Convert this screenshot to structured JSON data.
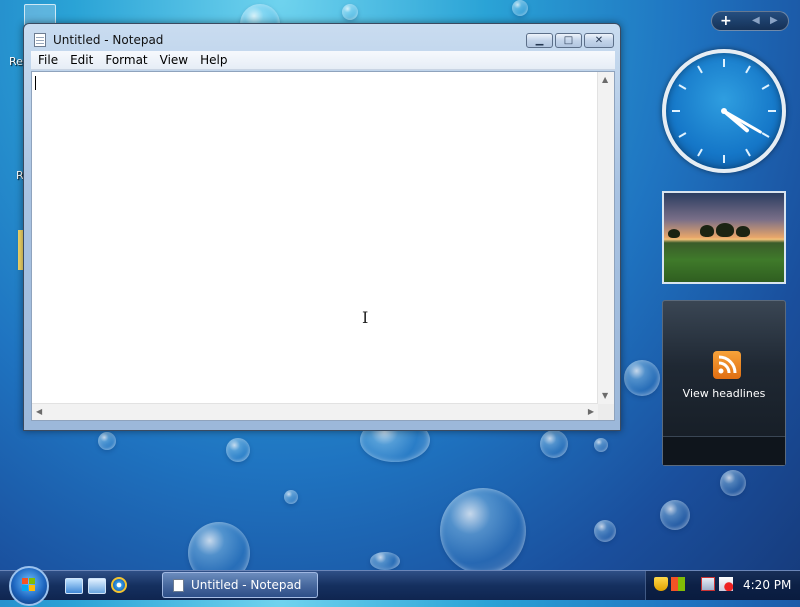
{
  "desktop": {
    "fragments": [
      "Re",
      "R"
    ]
  },
  "notepad": {
    "title": "Untitled - Notepad",
    "menu": [
      "File",
      "Edit",
      "Format",
      "View",
      "Help"
    ],
    "content": ""
  },
  "sidebar": {
    "add_symbol": "+",
    "nav_prev": "◀",
    "nav_next": "▶",
    "feed": {
      "label": "View headlines"
    }
  },
  "taskbar": {
    "task_label": "Untitled - Notepad",
    "clock": "4:20 PM"
  },
  "clock_gadget": {
    "hour": 4,
    "minute": 20
  },
  "colors": {
    "accent": "#1f74c1",
    "feed_icon": "#f7a33a"
  },
  "icons": {
    "start": "windows-orb-icon",
    "show_desktop": "show-desktop-icon",
    "switch_windows": "switch-windows-icon",
    "browser": "ie-icon",
    "security": "shield-icon",
    "network": "network-icon",
    "volume": "volume-muted-icon"
  }
}
